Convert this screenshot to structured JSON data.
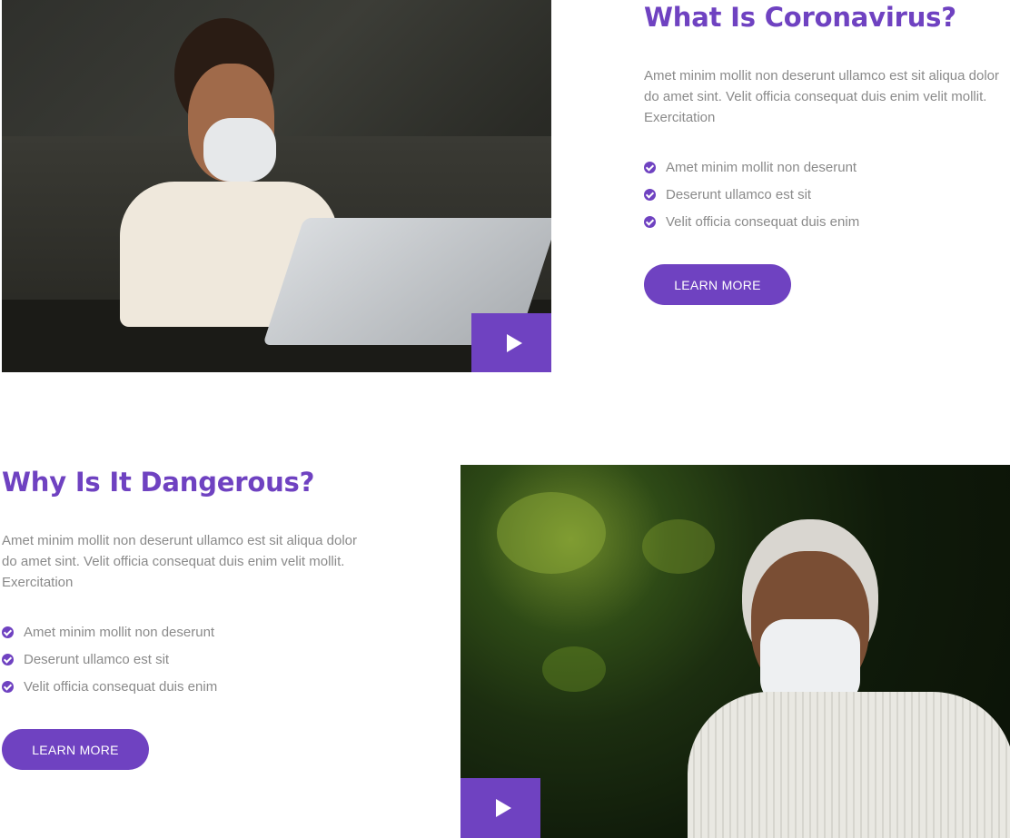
{
  "sections": [
    {
      "title": "What Is Coronavirus?",
      "description": "Amet minim mollit non deserunt ullamco est sit aliqua dolor do amet sint. Velit officia consequat duis enim velit mollit. Exercitation",
      "list": [
        "Amet minim mollit non deserunt",
        "Deserunt ullamco est sit",
        "Velit officia consequat duis enim"
      ],
      "button_label": "LEARN MORE"
    },
    {
      "title": "Why Is It Dangerous?",
      "description": "Amet minim mollit non deserunt ullamco est sit aliqua dolor do amet sint. Velit officia consequat duis enim velit mollit. Exercitation",
      "list": [
        "Amet minim mollit non deserunt",
        "Deserunt ullamco est sit",
        "Velit officia consequat duis enim"
      ],
      "button_label": "LEARN MORE"
    }
  ],
  "icons": {
    "play": "play-icon",
    "check": "check-circle-icon"
  },
  "colors": {
    "accent": "#6f42c1",
    "text_muted": "#8a8a8a"
  }
}
